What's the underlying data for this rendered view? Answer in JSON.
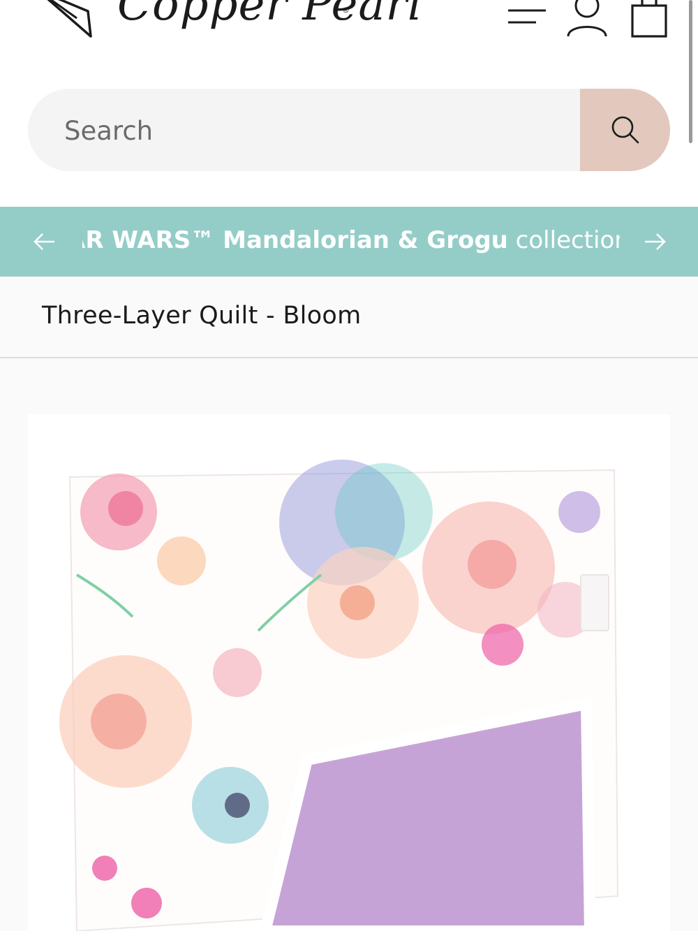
{
  "header": {
    "brand_name": "Copper Pearl",
    "brand_reg": "®"
  },
  "search": {
    "placeholder": "Search"
  },
  "announcement": {
    "bold_text": "AR WARS™ Mandalorian & Grogu",
    "light_text": " collection I"
  },
  "product": {
    "title": "Three-Layer Quilt - Bloom",
    "brand_tag": "Copper Pearl",
    "colors": {
      "quilt_back": "#c6a3d6",
      "quilt_front": "#fffdfb"
    }
  },
  "colors": {
    "announcement_bg": "#94cdc8",
    "search_button_bg": "#e2c8bd",
    "search_bg": "#f4f4f4"
  }
}
